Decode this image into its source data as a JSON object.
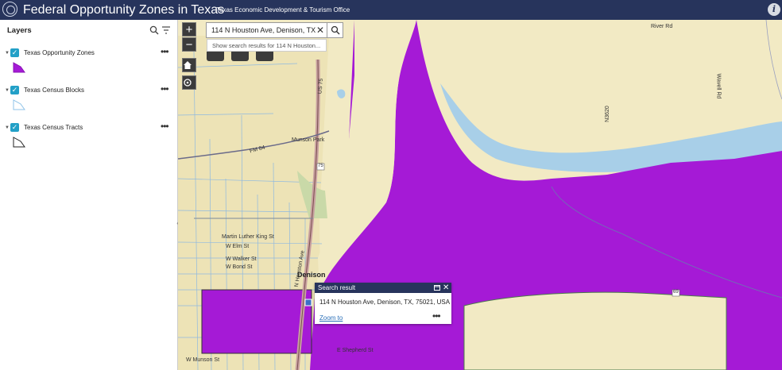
{
  "header": {
    "title": "Federal Opportunity Zones in Texas",
    "organization": "Texas Economic Development & Tourism Office",
    "bg_color": "#27345c"
  },
  "layers_panel": {
    "title": "Layers",
    "icons": [
      "search-icon",
      "filter-icon"
    ],
    "items": [
      {
        "label": "Texas Opportunity Zones",
        "checked": true,
        "swatch_color": "#a51ad6"
      },
      {
        "label": "Texas Census Blocks",
        "checked": true,
        "swatch_color": "#8fc3e8"
      },
      {
        "label": "Texas Census Tracts",
        "checked": true,
        "swatch_color": "#ffffff"
      }
    ]
  },
  "search": {
    "value": "114 N Houston Ave, Denison, TX",
    "suggestion": "Show search results for 114 N Houston..."
  },
  "popup": {
    "title": "Search result",
    "address": "114 N Houston Ave, Denison, TX, 75021, USA",
    "zoom_label": "Zoom to"
  },
  "map": {
    "colors": {
      "zone": "#a51ad6",
      "base": "#f2eac4",
      "water": "#a8cfe8",
      "urban": "#ede3b6"
    },
    "labels": {
      "city": "Denison",
      "river_rd": "River Rd",
      "wavell_rd": "Wavell Rd",
      "n3620": "N3620",
      "munson_park": "Munson Park",
      "mlk": "Martin Luther King St",
      "elm": "W Elm St",
      "walker": "W Walker St",
      "bond": "W Bond St",
      "shepherd": "E Shepherd St",
      "munson_st": "W Munson St",
      "houston": "N Houston Ave",
      "fm84": "FM 84",
      "us75": "US 75",
      "shields": [
        "75",
        "75",
        "69"
      ]
    }
  }
}
